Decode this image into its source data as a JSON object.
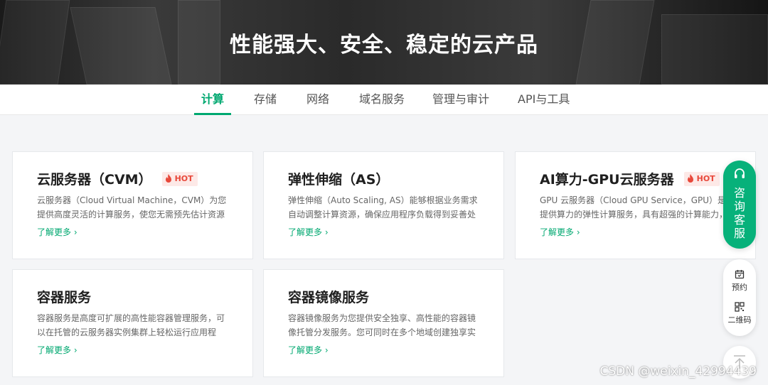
{
  "banner": {
    "title": "性能强大、安全、稳定的云产品"
  },
  "tabs": [
    {
      "label": "计算",
      "active": true
    },
    {
      "label": "存储",
      "active": false
    },
    {
      "label": "网络",
      "active": false
    },
    {
      "label": "域名服务",
      "active": false
    },
    {
      "label": "管理与审计",
      "active": false
    },
    {
      "label": "API与工具",
      "active": false
    }
  ],
  "cards": [
    {
      "title": "云服务器（CVM）",
      "hot": "HOT",
      "desc": "云服务器（Cloud Virtual Machine，CVM）为您提供高度灵活的计算服务，使您无需预先估计资源用...",
      "link": "了解更多"
    },
    {
      "title": "弹性伸缩（AS）",
      "desc": "弹性伸缩（Auto Scaling, AS）能够根据业务需求自动调整计算资源，确保应用程序负载得到妥善处理...",
      "link": "了解更多"
    },
    {
      "title": "AI算力-GPU云服务器",
      "hot": "HOT",
      "desc": "GPU 云服务器（Cloud GPU Service，GPU）是提供算力的弹性计算服务，具有超强的计算能力，服...",
      "link": "了解更多"
    },
    {
      "title": "容器服务",
      "desc": "容器服务是高度可扩展的高性能容器管理服务，可以在托管的云服务器实例集群上轻松运行应用程序。...",
      "link": "了解更多"
    },
    {
      "title": "容器镜像服务",
      "desc": "容器镜像服务为您提供安全独享、高性能的容器镜像托管分发服务。您可同时在多个地域创建独享实例...",
      "link": "了解更多"
    }
  ],
  "link_arrow": "›",
  "side": {
    "consult_label": "咨询客服",
    "consult_chars": [
      "咨",
      "询",
      "客",
      "服"
    ],
    "reserve": "预约",
    "qrcode": "二维码",
    "consult_icon": "headset-icon",
    "reserve_icon": "calendar-icon",
    "qrcode_icon": "qrcode-icon",
    "top_icon": "arrow-up-icon"
  },
  "watermark": "CSDN @weixin_42994439",
  "colors": {
    "accent": "#00a870",
    "hot": "#e8483a",
    "hot_bg": "#fde9e7"
  }
}
